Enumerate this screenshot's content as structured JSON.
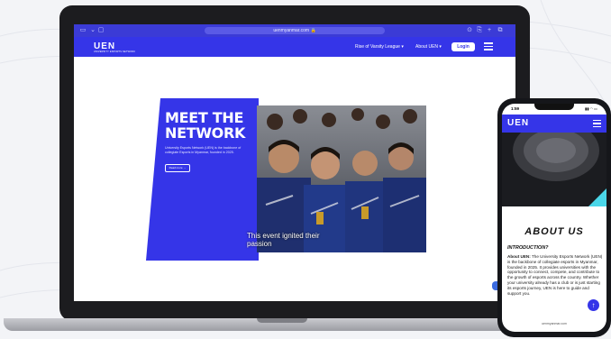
{
  "browser": {
    "url": "uenmyanmar.com"
  },
  "site_nav": {
    "logo": "UEN",
    "logo_tagline": "UNIVERSITY ESPORTS NETWORK",
    "menu_1": "Rise of Varsity League ▾",
    "menu_2": "About UEN ▾",
    "login": "Login"
  },
  "hero": {
    "title": "MEET THE NETWORK",
    "description": "University Esports Network (UEN) is the backbone of collegiate Esports in Myanmar, founded in 2025.",
    "button": "Read more →",
    "caption": "This event ignited their passion"
  },
  "phone": {
    "time": "1:59",
    "logo": "UEN",
    "about_title": "ABOUT US",
    "intro_heading": "INTRODUCTION?",
    "about_lead": "About UEN:",
    "about_text": " The University Esports Network (UEN) is the backbone of collegiate esports in Myanmar, founded in 2025. It provides universities with the opportunity to connect, compete, and contribute to the growth of esports across the country. Whether your university already has a club or is just starting its esports journey, UEN is here to guide and support you.",
    "footer_url": "uenmyanmar.com"
  },
  "colors": {
    "brand": "#3535e8",
    "laptop": "#1c1c1f"
  }
}
